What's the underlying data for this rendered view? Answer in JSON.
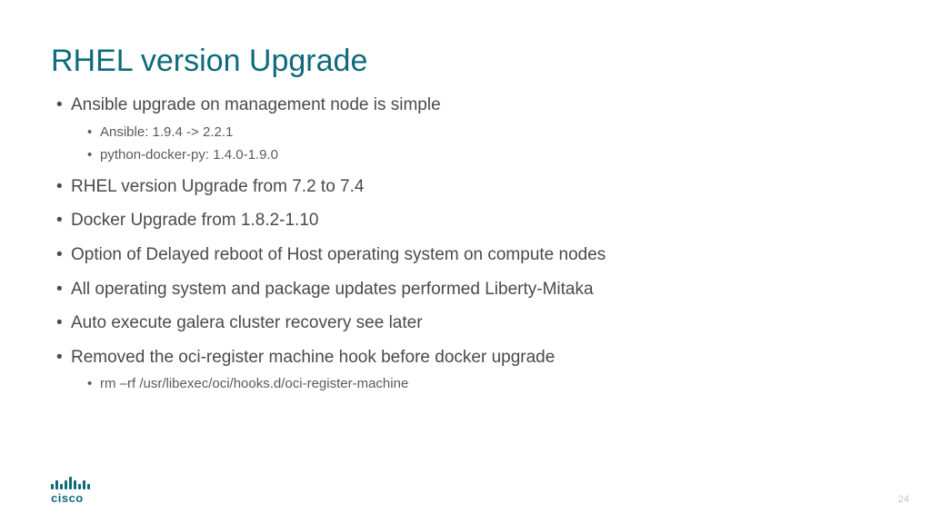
{
  "title": "RHEL version Upgrade",
  "bullets": [
    {
      "text": "Ansible upgrade on management node is simple",
      "sub": [
        "Ansible: 1.9.4 -> 2.2.1",
        "python-docker-py: 1.4.0-1.9.0"
      ]
    },
    {
      "text": "RHEL version Upgrade from 7.2 to 7.4"
    },
    {
      "text": "Docker Upgrade from 1.8.2-1.10"
    },
    {
      "text": "Option of Delayed reboot of Host operating system on compute nodes"
    },
    {
      "text": "All operating system and package updates performed Liberty-Mitaka"
    },
    {
      "text": "Auto execute galera cluster recovery see later"
    },
    {
      "text": "Removed the oci-register machine hook before docker upgrade",
      "sub": [
        "rm –rf /usr/libexec/oci/hooks.d/oci-register-machine"
      ]
    }
  ],
  "logo_text": "cisco",
  "page_number": "24"
}
